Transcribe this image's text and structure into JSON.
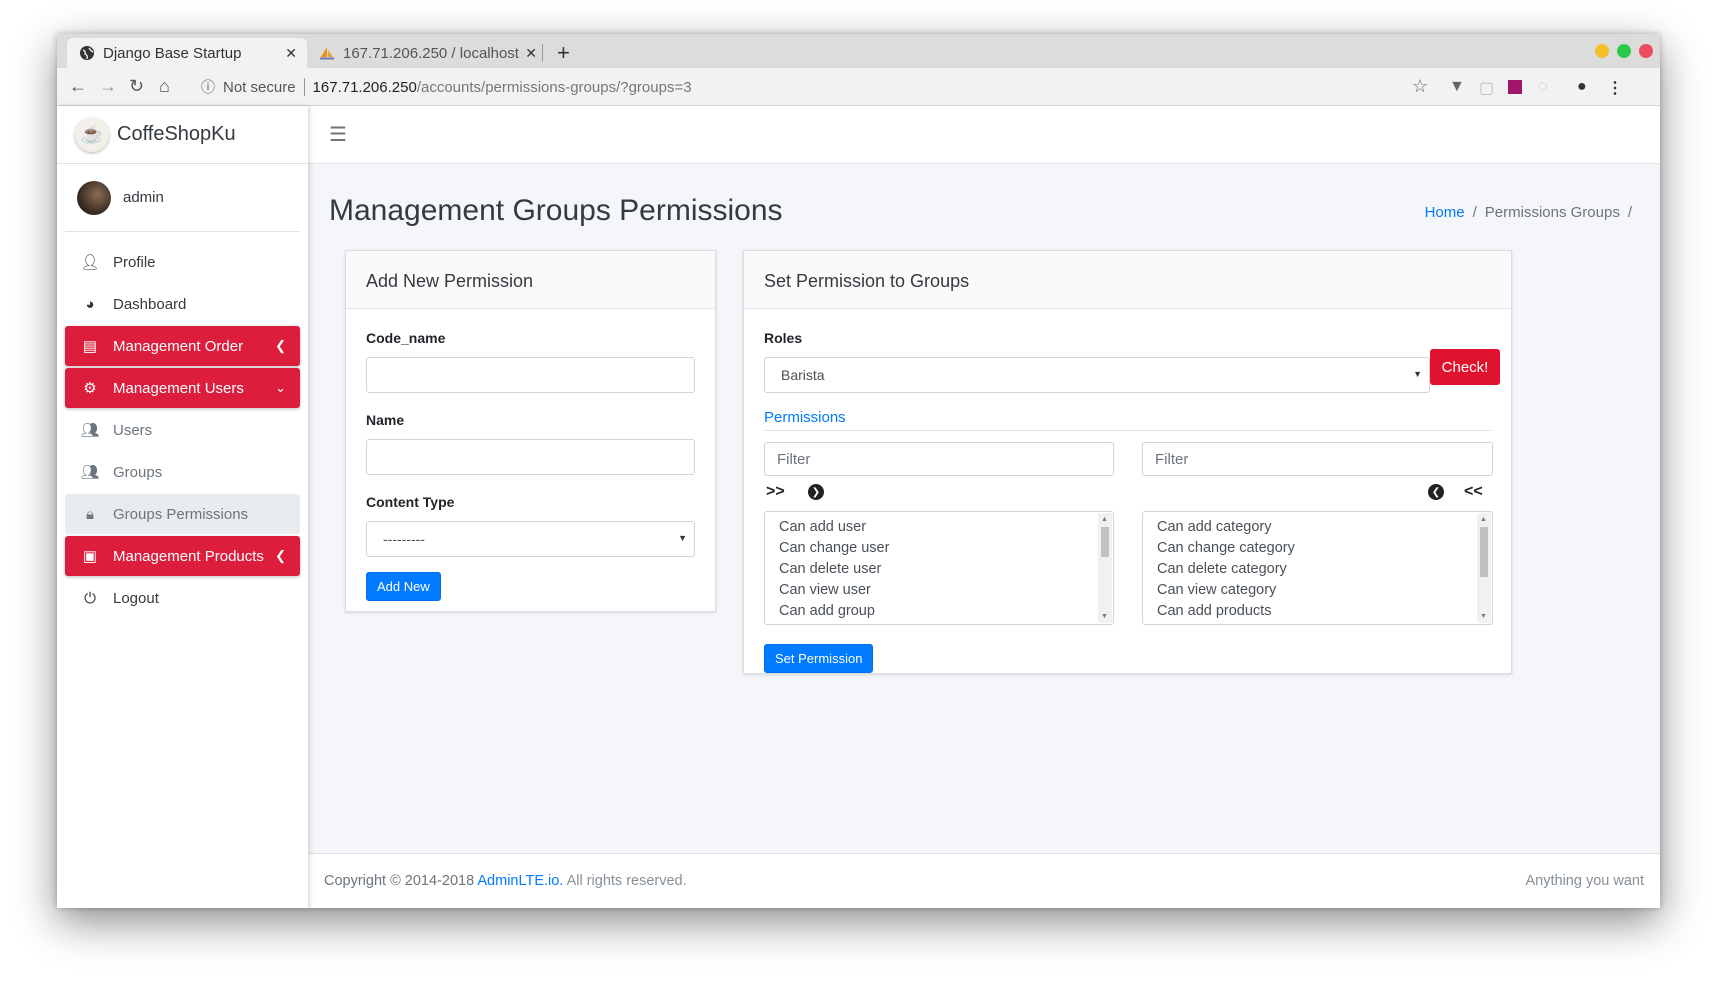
{
  "browser": {
    "tabs": [
      {
        "title": "Django Base Startup",
        "active": true
      },
      {
        "title": "167.71.206.250 / localhost",
        "active": false
      }
    ],
    "new_tab": "+",
    "url": {
      "security": "Not secure",
      "host": "167.71.206.250",
      "path": "/accounts/permissions-groups/?groups=3"
    },
    "colors": {
      "close": "#ed4c5c",
      "minimize": "#f5bf2a",
      "maximize": "#2dc94c"
    }
  },
  "sidebar": {
    "brand": "CoffeShopKu",
    "user": "admin",
    "items": [
      {
        "label": "Profile",
        "icon": "user-icon"
      },
      {
        "label": "Dashboard",
        "icon": "dashboard-icon"
      },
      {
        "label": "Management Order",
        "icon": "cash-register-icon"
      },
      {
        "label": "Management Users",
        "icon": "users-cog-icon"
      },
      {
        "label": "Users",
        "icon": "users-icon"
      },
      {
        "label": "Groups",
        "icon": "user-friends-icon"
      },
      {
        "label": "Groups Permissions",
        "icon": "user-lock-icon"
      },
      {
        "label": "Management Products",
        "icon": "gift-icon"
      },
      {
        "label": "Logout",
        "icon": "power-icon"
      }
    ],
    "accent": "#dc1e3c"
  },
  "page": {
    "title": "Management Groups Permissions",
    "breadcrumb": [
      "Home",
      "Permissions Groups"
    ],
    "breadcrumb_sep": "/"
  },
  "add_permission": {
    "header": "Add New Permission",
    "code_name_label": "Code_name",
    "code_name_value": "",
    "name_label": "Name",
    "name_value": "",
    "content_type_label": "Content Type",
    "content_type_value": "---------",
    "submit": "Add New"
  },
  "set_permission": {
    "header": "Set Permission to Groups",
    "roles_label": "Roles",
    "roles_value": "Barista",
    "check_button": "Check!",
    "permissions_label": "Permissions",
    "filter_placeholder": "Filter",
    "move_all_right": ">>",
    "move_all_left": "<<",
    "available": [
      "Can add user",
      "Can change user",
      "Can delete user",
      "Can view user",
      "Can add group"
    ],
    "selected": [
      "Can add category",
      "Can change category",
      "Can delete category",
      "Can view category",
      "Can add products"
    ],
    "submit": "Set Permission"
  },
  "footer": {
    "copyright": "Copyright © 2014-2018",
    "link": "AdminLTE.io.",
    "rights": "All rights reserved.",
    "right_text": "Anything you want"
  }
}
